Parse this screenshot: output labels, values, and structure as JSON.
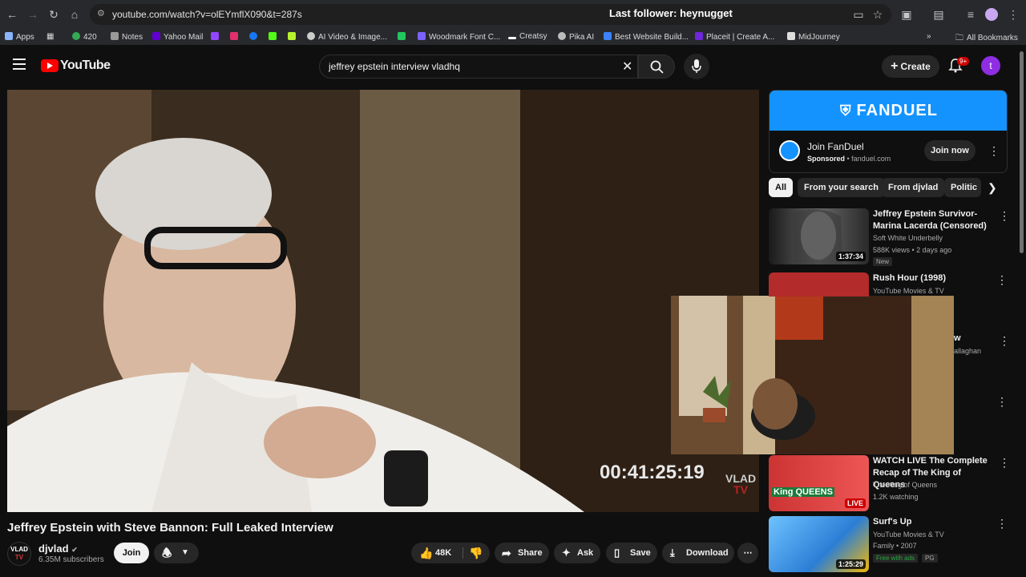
{
  "browser": {
    "url": "youtube.com/watch?v=olEYmflX090&t=287s",
    "overlay_text": "Last follower: heynugget",
    "bookmarks": [
      {
        "label": "Apps",
        "color": "#8ab4f8"
      },
      {
        "label": "420",
        "color": "#34a853"
      },
      {
        "label": "Notes",
        "color": "#999999"
      },
      {
        "label": "Yahoo Mail",
        "color": "#6001d2"
      },
      {
        "label": "AI Video & Image...",
        "color": "#cccccc"
      },
      {
        "label": "Woodmark Font C...",
        "color": "#7b61ff"
      },
      {
        "label": "Creatsy",
        "color": "#ffffff"
      },
      {
        "label": "Pika AI",
        "color": "#bbbbbb"
      },
      {
        "label": "Best Website Build...",
        "color": "#3b82f6"
      },
      {
        "label": "Placeit | Create A...",
        "color": "#6d28d9"
      },
      {
        "label": "MidJourney",
        "color": "#dddddd"
      }
    ],
    "all_bookmarks": "All Bookmarks"
  },
  "header": {
    "logo_text": "YouTube",
    "search_value": "jeffrey epstein interview vladhq",
    "create_label": "Create",
    "notifications_badge": "9+",
    "avatar_letter": "t"
  },
  "video": {
    "timecode": "00:41:25:19",
    "watermark_line1": "VLAD",
    "watermark_line2": "TV",
    "title": "Jeffrey Epstein with Steve Bannon: Full Leaked Interview"
  },
  "channel": {
    "avatar_line1": "VLAD",
    "avatar_line2": "TV",
    "name": "djvlad",
    "subscribers": "6.35M subscribers",
    "join_label": "Join"
  },
  "actions": {
    "likes": "48K",
    "share": "Share",
    "ask": "Ask",
    "save": "Save",
    "download": "Download"
  },
  "ad": {
    "banner": "FANDUEL",
    "title": "Join FanDuel",
    "sponsored": "Sponsored",
    "domain": "fanduel.com",
    "cta": "Join now"
  },
  "chips": [
    "All",
    "From your search",
    "From djvlad",
    "Politic"
  ],
  "recommendations": [
    {
      "title": "Jeffrey Epstein Survivor-Marina Lacerda (Censored)",
      "channel": "Soft White Underbelly",
      "meta": "588K views • 2 days ago",
      "badge": "New",
      "duration": "1:37:34"
    },
    {
      "title": "Rush Hour (1998)",
      "channel": "YouTube Movies & TV",
      "meta": "",
      "badge": "",
      "duration": ""
    },
    {
      "title": "WATCH LIVE The Complete Recap of The King of Queens",
      "channel": "The King of Queens",
      "meta": "1.2K watching",
      "badge": "",
      "duration": "LIVE",
      "thumb_label": "King QUEENS"
    },
    {
      "title": "Surf's Up",
      "channel": "YouTube Movies & TV",
      "meta": "Family • 2007",
      "badge": "Free with ads",
      "badge2": "PG",
      "duration": "1:25:29"
    }
  ],
  "partial_text": {
    "fragment1": "w",
    "fragment2": "allaghan"
  }
}
